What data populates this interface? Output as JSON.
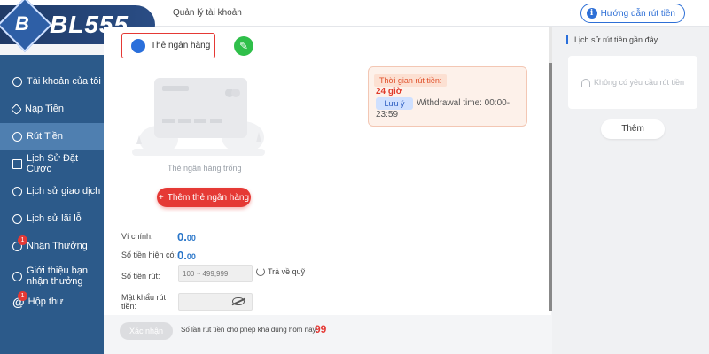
{
  "logo": {
    "text": "BL555"
  },
  "header": {
    "breadcrumb": "Quản lý tài khoản",
    "help_button": "Hướng dẫn rút tiền",
    "help_icon": "info-icon"
  },
  "sidebar": {
    "active_index": 2,
    "items": [
      {
        "label": "Tài khoản của tôi",
        "icon": "account-icon"
      },
      {
        "label": "Nạp Tiền",
        "icon": "deposit-icon"
      },
      {
        "label": "Rút Tiền",
        "icon": "withdraw-icon"
      },
      {
        "label": "Lịch Sử Đặt Cược",
        "icon": "bet-history-icon"
      },
      {
        "label": "Lịch sử giao dịch",
        "icon": "transaction-history-icon"
      },
      {
        "label": "Lịch sử lãi lỗ",
        "icon": "profit-loss-icon"
      },
      {
        "label": "Nhận Thưởng",
        "icon": "reward-icon",
        "badge": "1"
      },
      {
        "label": "Giới thiệu bạn nhận thưởng",
        "icon": "referral-icon"
      },
      {
        "label": "Hộp thư",
        "icon": "mailbox-icon",
        "badge": "1"
      }
    ]
  },
  "main": {
    "bank_tab": "Thẻ ngân hàng",
    "empty_text": "Thẻ ngân hàng trống",
    "add_card_button": "Thêm thẻ ngân hàng",
    "info": {
      "title": "Thời gian rút tiền:",
      "hours": "24 giờ",
      "note_tag": "Lưu ý",
      "note": "Withdrawal time: 00:00-23:59"
    },
    "main_wallet_label": "Ví chính:",
    "main_wallet_value": "0.",
    "main_wallet_decimals": "00",
    "available_label": "Số tiền hiện có:",
    "available_value": "0.",
    "available_decimals": "00",
    "amount_label": "Số tiền rút:",
    "amount_placeholder": "100 ~ 499,999",
    "withdraw_all": "Trả về quỹ",
    "password_label": "Mật khẩu rút tiền:",
    "confirm_button": "Xác nhận",
    "limit_text": "Số lần rút tiền cho phép khả dụng hôm nay:",
    "limit_value": "99"
  },
  "right_panel": {
    "title": "Lịch sử rút tiền gần đây",
    "empty_text": "Không có yêu cầu rút tiền",
    "more_button": "Thêm"
  },
  "colors": {
    "sidebar_bg": "#2c5a8a",
    "accent_red": "#e53935",
    "accent_blue": "#2a76c9",
    "edit_green": "#2fbf4a"
  }
}
